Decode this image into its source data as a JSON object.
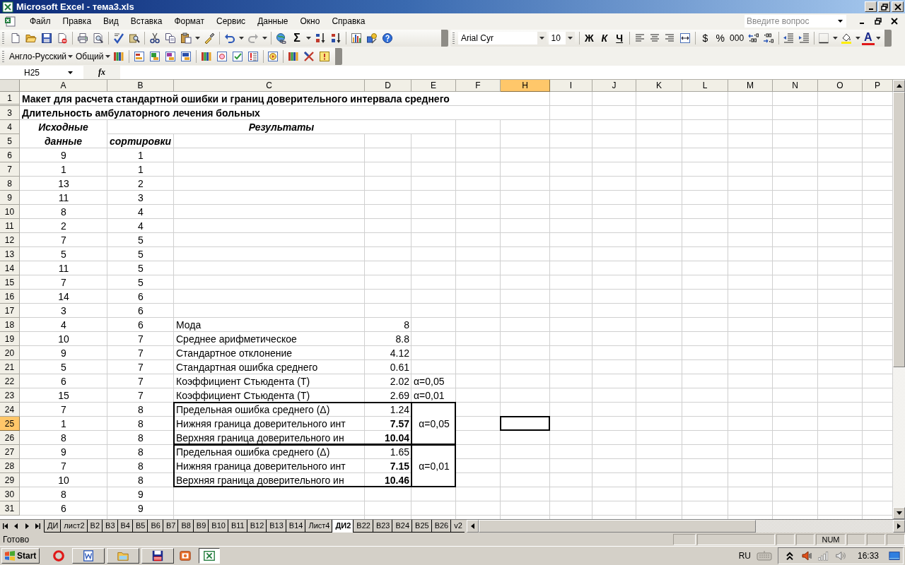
{
  "window": {
    "title": "Microsoft Excel - тема3.xls"
  },
  "menu": [
    "Файл",
    "Правка",
    "Вид",
    "Вставка",
    "Формат",
    "Сервис",
    "Данные",
    "Окно",
    "Справка"
  ],
  "help_box": {
    "placeholder": "Введите вопрос"
  },
  "standard_toolbar": {
    "autosum": "Σ"
  },
  "formatting_toolbar": {
    "font": "Arial Cyr",
    "size": "10",
    "bold": "Ж",
    "italic": "К",
    "underline": "Ч",
    "currency": "$",
    "percent": "%",
    "thousands": "000",
    "font_color": "A"
  },
  "dictionary_toolbar": {
    "dictionary": "Англо-Русский",
    "subject": "Общий"
  },
  "formula_bar": {
    "name_box": "H25",
    "fx": "fx"
  },
  "sheet": {
    "columns": [
      {
        "label": "A",
        "selected": false
      },
      {
        "label": "B",
        "selected": false
      },
      {
        "label": "C",
        "selected": false
      },
      {
        "label": "D",
        "selected": false
      },
      {
        "label": "E",
        "selected": false
      },
      {
        "label": "F",
        "selected": false
      },
      {
        "label": "H",
        "selected": true
      },
      {
        "label": "I",
        "selected": false
      },
      {
        "label": "J",
        "selected": false
      },
      {
        "label": "K",
        "selected": false
      },
      {
        "label": "L",
        "selected": false
      },
      {
        "label": "M",
        "selected": false
      },
      {
        "label": "N",
        "selected": false
      },
      {
        "label": "O",
        "selected": false
      },
      {
        "label": "P",
        "selected": false
      }
    ],
    "rows": [
      {
        "kind": "title",
        "number": "1",
        "selected": false,
        "a": "Макет для расчета стандартной ошибки и границ доверительного интервала среднего"
      },
      {
        "kind": "title",
        "number": "3",
        "selected": false,
        "a": "Длительность амбулаторного лечения больных"
      },
      {
        "kind": "header",
        "number": "4",
        "selected": false,
        "a": "Исходные данные",
        "merged_b_e": "Результаты"
      },
      {
        "kind": "header",
        "number": "5",
        "selected": false,
        "b": "сортировки"
      },
      {
        "kind": "data",
        "number": "6",
        "selected": false,
        "a": "9",
        "b": "1"
      },
      {
        "kind": "data",
        "number": "7",
        "selected": false,
        "a": "1",
        "b": "1"
      },
      {
        "kind": "data",
        "number": "8",
        "selected": false,
        "a": "13",
        "b": "2"
      },
      {
        "kind": "data",
        "number": "9",
        "selected": false,
        "a": "11",
        "b": "3"
      },
      {
        "kind": "data",
        "number": "10",
        "selected": false,
        "a": "8",
        "b": "4"
      },
      {
        "kind": "data",
        "number": "11",
        "selected": false,
        "a": "2",
        "b": "4"
      },
      {
        "kind": "data",
        "number": "12",
        "selected": false,
        "a": "7",
        "b": "5"
      },
      {
        "kind": "data",
        "number": "13",
        "selected": false,
        "a": "5",
        "b": "5"
      },
      {
        "kind": "data",
        "number": "14",
        "selected": false,
        "a": "11",
        "b": "5"
      },
      {
        "kind": "data",
        "number": "15",
        "selected": false,
        "a": "7",
        "b": "5"
      },
      {
        "kind": "data",
        "number": "16",
        "selected": false,
        "a": "14",
        "b": "6"
      },
      {
        "kind": "data",
        "number": "17",
        "selected": false,
        "a": "3",
        "b": "6"
      },
      {
        "kind": "data",
        "number": "18",
        "selected": false,
        "a": "4",
        "b": "6",
        "c": "Мода",
        "d": "8",
        "d_bold": false
      },
      {
        "kind": "data",
        "number": "19",
        "selected": false,
        "a": "10",
        "b": "7",
        "c": "Среднее арифметическое",
        "d": "8.8",
        "d_bold": false
      },
      {
        "kind": "data",
        "number": "20",
        "selected": false,
        "a": "9",
        "b": "7",
        "c": "Стандартное отклонение",
        "d": "4.12",
        "d_bold": false
      },
      {
        "kind": "data",
        "number": "21",
        "selected": false,
        "a": "5",
        "b": "7",
        "c": "Стандартная ошибка среднего",
        "d": "0.61",
        "d_bold": false
      },
      {
        "kind": "data",
        "number": "22",
        "selected": false,
        "a": "6",
        "b": "7",
        "c": "Коэффициент Стьюдента (Т)",
        "d": "2.02",
        "d_bold": false,
        "e": "α=0,05"
      },
      {
        "kind": "data",
        "number": "23",
        "selected": false,
        "a": "15",
        "b": "7",
        "c": "Коэффициент Стьюдента (Т)",
        "d": "2.69",
        "d_bold": false,
        "e": "α=0,01"
      },
      {
        "kind": "box",
        "label": "α=0,05",
        "rows": [
          {
            "number": "24",
            "selected": false,
            "a": "7",
            "b": "8",
            "c": "Предельная ошибка среднего (Δ)",
            "d": "1.24",
            "d_bold": false
          },
          {
            "number": "25",
            "selected": true,
            "a": "1",
            "b": "8",
            "c": "Нижняя граница доверительного инт",
            "d": "7.57",
            "d_bold": true
          },
          {
            "number": "26",
            "selected": false,
            "a": "8",
            "b": "8",
            "c": "Верхняя граница доверительного ин",
            "d": "10.04",
            "d_bold": true
          }
        ]
      },
      {
        "kind": "box",
        "label": "α=0,01",
        "rows": [
          {
            "number": "27",
            "selected": false,
            "a": "9",
            "b": "8",
            "c": "Предельная ошибка среднего (Δ)",
            "d": "1.65",
            "d_bold": false
          },
          {
            "number": "28",
            "selected": false,
            "a": "7",
            "b": "8",
            "c": "Нижняя граница доверительного инт",
            "d": "7.15",
            "d_bold": true
          },
          {
            "number": "29",
            "selected": false,
            "a": "10",
            "b": "8",
            "c": "Верхняя граница доверительного ин",
            "d": "10.46",
            "d_bold": true
          }
        ]
      },
      {
        "kind": "data",
        "number": "30",
        "selected": false,
        "a": "8",
        "b": "9"
      },
      {
        "kind": "data",
        "number": "31",
        "selected": false,
        "a": "6",
        "b": "9"
      }
    ]
  },
  "sheet_tabs": [
    {
      "label": "ДИ",
      "selected": false
    },
    {
      "label": "лист2",
      "selected": false
    },
    {
      "label": "B2",
      "selected": false
    },
    {
      "label": "B3",
      "selected": false
    },
    {
      "label": "B4",
      "selected": false
    },
    {
      "label": "B5",
      "selected": false
    },
    {
      "label": "B6",
      "selected": false
    },
    {
      "label": "B7",
      "selected": false
    },
    {
      "label": "B8",
      "selected": false
    },
    {
      "label": "B9",
      "selected": false
    },
    {
      "label": "B10",
      "selected": false
    },
    {
      "label": "B11",
      "selected": false
    },
    {
      "label": "B12",
      "selected": false
    },
    {
      "label": "B13",
      "selected": false
    },
    {
      "label": "B14",
      "selected": false
    },
    {
      "label": "Лист4",
      "selected": false
    },
    {
      "label": "ДИ2",
      "selected": true
    },
    {
      "label": "B22",
      "selected": false
    },
    {
      "label": "B23",
      "selected": false
    },
    {
      "label": "B24",
      "selected": false
    },
    {
      "label": "B25",
      "selected": false
    },
    {
      "label": "B26",
      "selected": false
    },
    {
      "label": "v2",
      "selected": false
    }
  ],
  "status_bar": {
    "status": "Готово",
    "num": "NUM"
  },
  "taskbar": {
    "start": "Start",
    "apps": [
      {
        "kind": "launcher",
        "active": false
      },
      {
        "kind": "window",
        "active": false
      },
      {
        "kind": "window",
        "active": false
      },
      {
        "kind": "window",
        "active": false
      },
      {
        "kind": "launcher",
        "active": false
      },
      {
        "kind": "window",
        "active": true
      }
    ],
    "language": "RU",
    "clock": "16:33"
  }
}
